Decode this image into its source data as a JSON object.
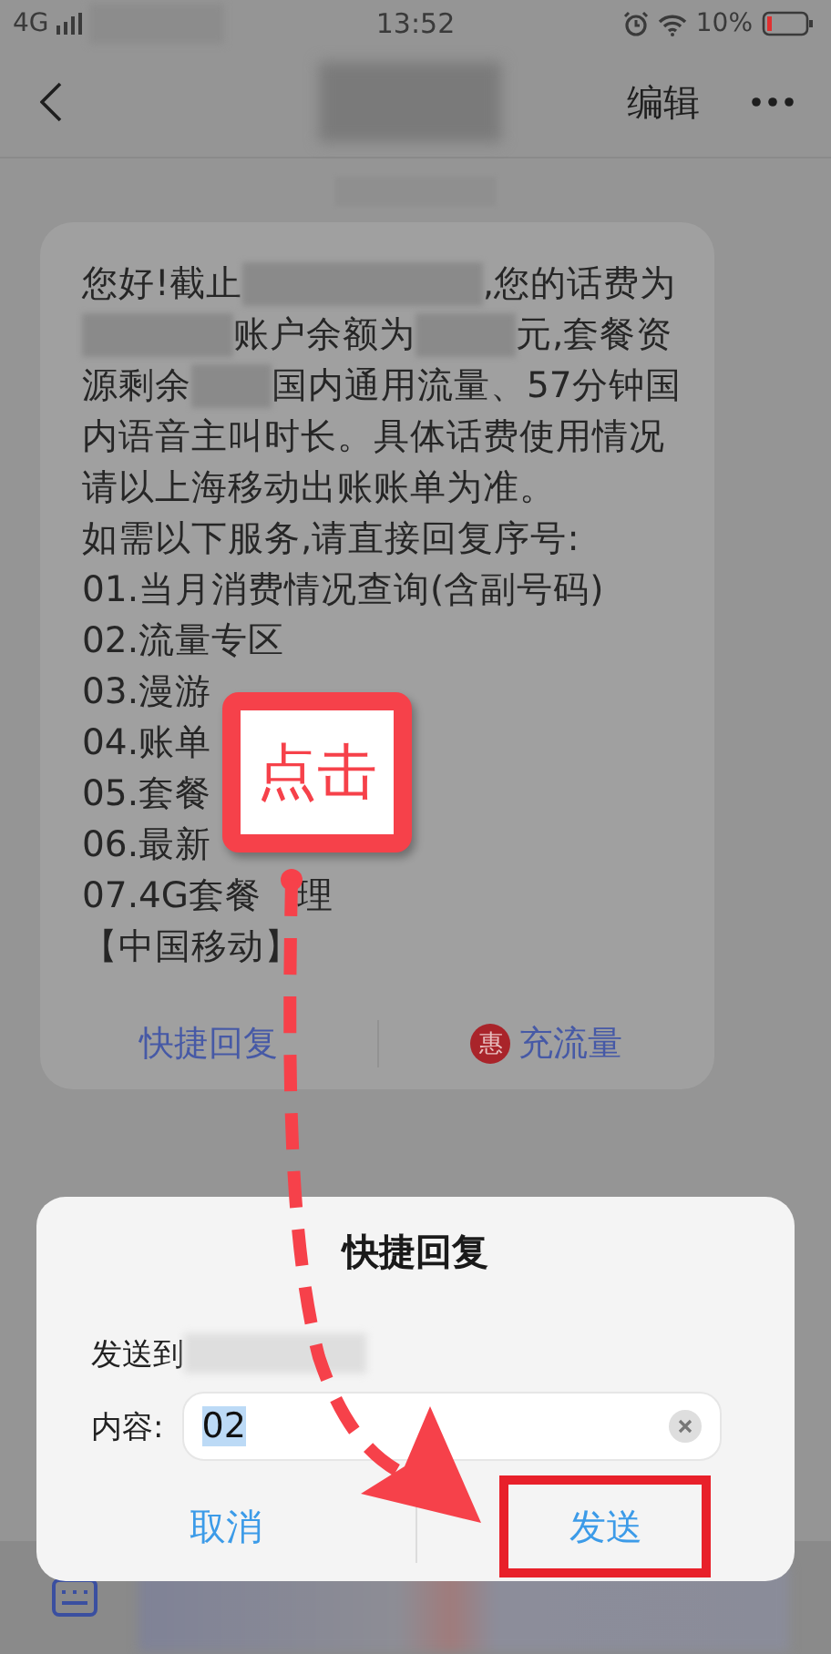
{
  "status_bar": {
    "network": "4G",
    "time": "13:52",
    "battery": "10%"
  },
  "nav": {
    "edit": "编辑"
  },
  "message": {
    "lines": [
      [
        {
          "text": "您好!截止"
        },
        {
          "kind": "redacted"
        },
        {
          "text": ",您的话费为"
        }
      ],
      [
        {
          "kind": "redacted"
        },
        {
          "text": "账户余额为"
        },
        {
          "kind": "redacted"
        },
        {
          "text": "元,套餐资"
        }
      ],
      [
        {
          "text": "源剩余"
        },
        {
          "kind": "redacted"
        },
        {
          "text": "国内通用流量、57分钟国"
        }
      ],
      [
        {
          "text": "内语音主叫时长。具体话费使用情况"
        }
      ],
      [
        {
          "text": "请以上海移动出账账单为准。"
        }
      ],
      [
        {
          "text": "如需以下服务,请直接回复序号:"
        }
      ],
      [
        {
          "text": "01.当月消费情况查询(含副号码)"
        }
      ],
      [
        {
          "text": "02.流量专区"
        }
      ],
      [
        {
          "text": "03.漫游"
        }
      ],
      [
        {
          "text": "04.账单"
        }
      ],
      [
        {
          "text": "05.套餐"
        }
      ],
      [
        {
          "text": "06.最新"
        }
      ],
      [
        {
          "text": "07.4G套餐"
        },
        {
          "kind": "covered"
        },
        {
          "text": "理"
        }
      ],
      [
        {
          "text": "【中国移动】"
        }
      ]
    ],
    "actions": [
      {
        "label": "快捷回复"
      },
      {
        "label": "充流量",
        "badge": "惠"
      }
    ]
  },
  "dialog": {
    "title": "快捷回复",
    "send_to_label": "发送到",
    "content_label": "内容:",
    "content": {
      "value": "02",
      "text_selected": true
    },
    "buttons": [
      {
        "label": "取消",
        "highlighted": false
      },
      {
        "label": "发送",
        "highlighted": true
      }
    ]
  },
  "annotation": {
    "callout": "点击"
  }
}
